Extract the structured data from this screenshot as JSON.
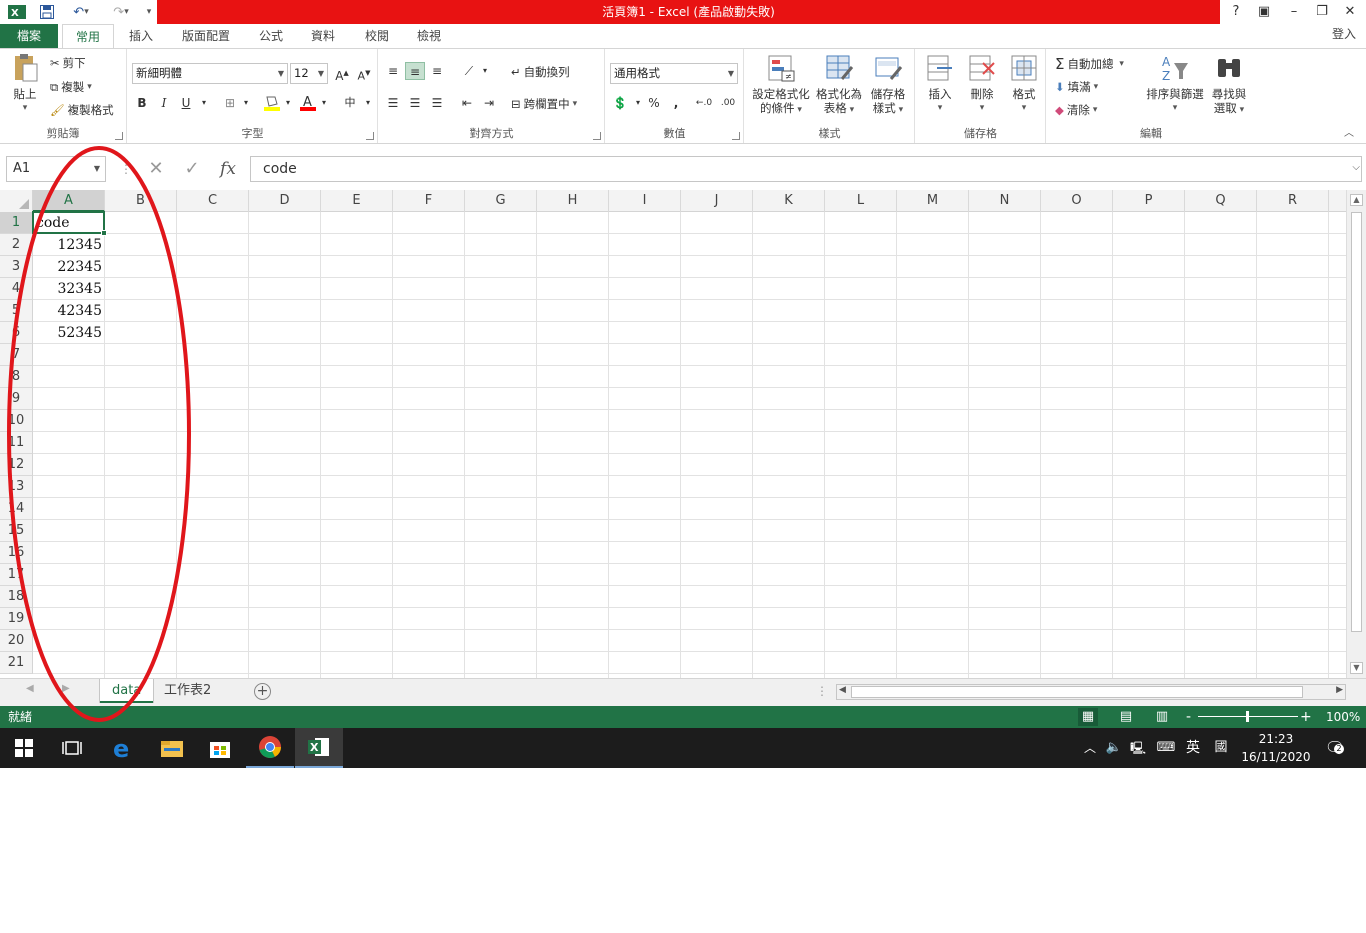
{
  "window": {
    "title": "活頁簿1 - Excel (產品啟動失敗)",
    "help_label": "?",
    "signin_label": "登入"
  },
  "tabs": {
    "file": "檔案",
    "items": [
      "常用",
      "插入",
      "版面配置",
      "公式",
      "資料",
      "校閱",
      "檢視"
    ],
    "active": "常用"
  },
  "ribbon": {
    "clipboard": {
      "label": "剪貼簿",
      "paste": "貼上",
      "cut": "剪下",
      "copy": "複製",
      "format_painter": "複製格式"
    },
    "font": {
      "label": "字型",
      "font_name": "新細明體",
      "font_size": "12",
      "bold": "B",
      "italic": "I",
      "underline": "U"
    },
    "alignment": {
      "label": "對齊方式",
      "wrap_text": "自動換列",
      "merge_center": "跨欄置中"
    },
    "number": {
      "label": "數值",
      "format": "通用格式",
      "percent": "%",
      "comma": ","
    },
    "styles": {
      "label": "樣式",
      "conditional_line1": "設定格式化",
      "conditional_line2": "的條件",
      "format_table_line1": "格式化為",
      "format_table_line2": "表格",
      "cell_styles_line1": "儲存格",
      "cell_styles_line2": "樣式"
    },
    "cells": {
      "label": "儲存格",
      "insert": "插入",
      "delete": "刪除",
      "format": "格式"
    },
    "editing": {
      "label": "編輯",
      "autosum": "自動加總",
      "fill": "填滿",
      "clear": "清除",
      "sort_line1": "排序與篩選",
      "find_line1": "尋找與",
      "find_line2": "選取"
    }
  },
  "formula_bar": {
    "name_box": "A1",
    "fx": "fx",
    "content": "code"
  },
  "sheet": {
    "columns": [
      "A",
      "B",
      "C",
      "D",
      "E",
      "F",
      "G",
      "H",
      "I",
      "J",
      "K",
      "L",
      "M",
      "N",
      "O",
      "P",
      "Q",
      "R"
    ],
    "rows": [
      "1",
      "2",
      "3",
      "4",
      "5",
      "6",
      "7",
      "8",
      "9",
      "10",
      "11",
      "12",
      "13",
      "14",
      "15",
      "16",
      "17",
      "18",
      "19",
      "20",
      "21"
    ],
    "cells": {
      "A1": "code",
      "A2": "12345",
      "A3": "22345",
      "A4": "32345",
      "A5": "42345",
      "A6": "52345"
    },
    "selected_cell": "A1"
  },
  "sheet_tabs": {
    "items": [
      "data",
      "工作表2"
    ],
    "active": "data"
  },
  "status_bar": {
    "status": "就緒",
    "zoom": "100%",
    "zoom_minus": "-",
    "zoom_plus": "+"
  },
  "taskbar": {
    "ime_lang": "英",
    "ime_mode": "國",
    "time": "21:23",
    "date": "16/11/2020",
    "notifications": "2"
  },
  "colors": {
    "excel_green": "#217346",
    "title_red": "#e81212",
    "annotation_red": "#e0161b"
  }
}
